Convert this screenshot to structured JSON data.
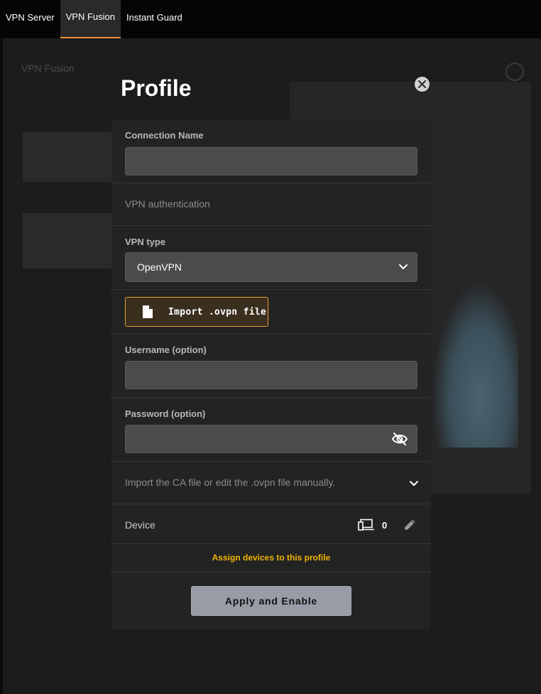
{
  "nav": {
    "tabs": [
      {
        "label": "VPN Server"
      },
      {
        "label": "VPN Fusion"
      },
      {
        "label": "Instant Guard"
      }
    ],
    "active_index": 1
  },
  "background": {
    "page_title": "VPN Fusion"
  },
  "modal": {
    "title": "Profile",
    "connection_name": {
      "label": "Connection Name",
      "value": ""
    },
    "vpn_authentication": "VPN authentication",
    "vpn_type": {
      "label": "VPN type",
      "selected": "OpenVPN"
    },
    "import_button": "Import .ovpn file",
    "username": {
      "label": "Username (option)",
      "value": ""
    },
    "password": {
      "label": "Password (option)",
      "value": ""
    },
    "ca_section": "Import the CA file or edit the .ovpn file manually.",
    "device": {
      "label": "Device",
      "count": "0"
    },
    "assign_link": "Assign devices to this profile",
    "apply_button": "Apply and Enable"
  },
  "colors": {
    "accent": "#e8903a",
    "import_border": "#e8a02f",
    "assign_link": "#f0b400",
    "apply_bg": "#999ca6"
  },
  "icons": [
    "close-icon",
    "file-icon",
    "chevron-down-icon",
    "eye-off-icon",
    "devices-icon",
    "pencil-icon"
  ]
}
